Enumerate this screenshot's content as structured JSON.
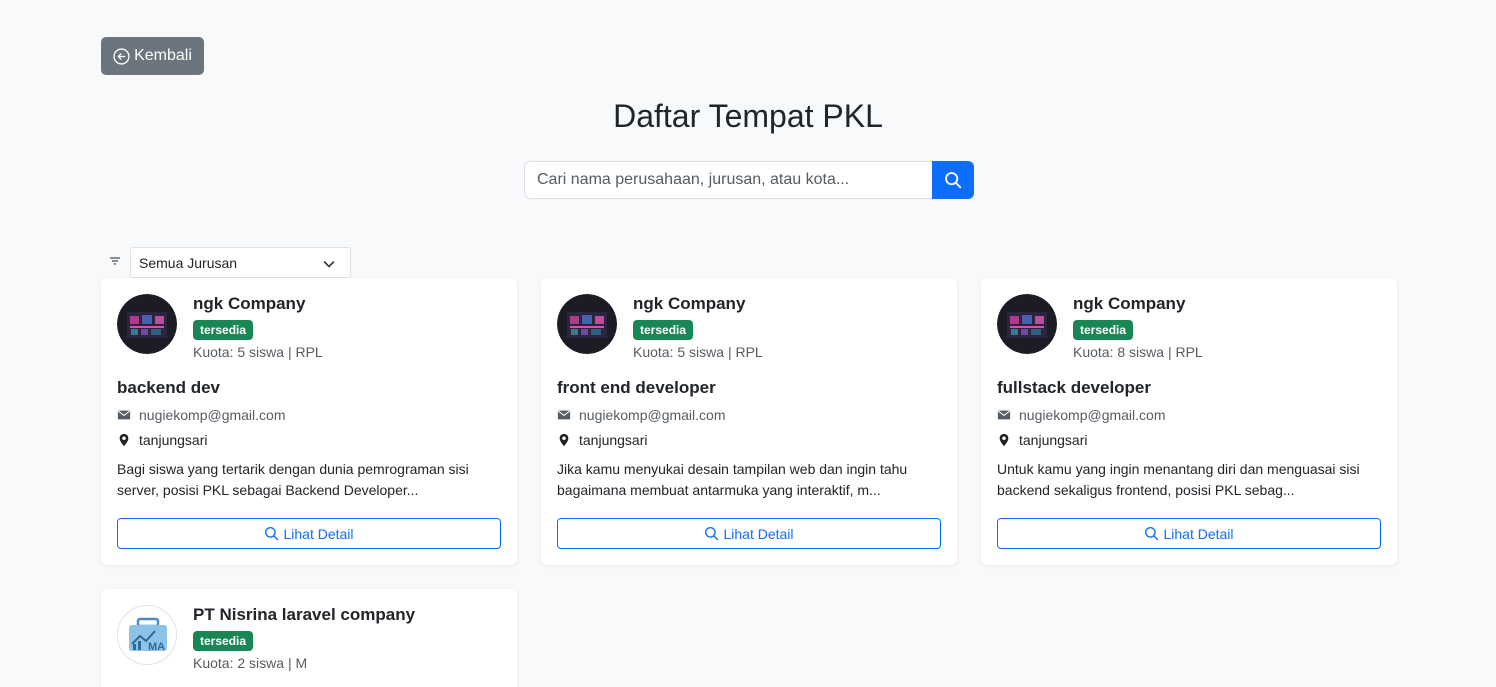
{
  "back_button": {
    "label": "Kembali"
  },
  "page_title": "Daftar Tempat PKL",
  "search": {
    "placeholder": "Cari nama perusahaan, jurusan, atau kota..."
  },
  "filter": {
    "selected": "Semua Jurusan"
  },
  "cards": [
    {
      "company": "ngk Company",
      "status": "tersedia",
      "quota": "Kuota: 5 siswa | RPL",
      "position": "backend dev",
      "email": "nugiekomp@gmail.com",
      "location": "tanjungsari",
      "description": "Bagi siswa yang tertarik dengan dunia pemrograman sisi server, posisi PKL sebagai Backend Developer...",
      "detail_label": "Lihat Detail"
    },
    {
      "company": "ngk Company",
      "status": "tersedia",
      "quota": "Kuota: 5 siswa | RPL",
      "position": "front end developer",
      "email": "nugiekomp@gmail.com",
      "location": "tanjungsari",
      "description": "Jika kamu menyukai desain tampilan web dan ingin tahu bagaimana membuat antarmuka yang interaktif, m...",
      "detail_label": "Lihat Detail"
    },
    {
      "company": "ngk Company",
      "status": "tersedia",
      "quota": "Kuota: 8 siswa | RPL",
      "position": "fullstack developer",
      "email": "nugiekomp@gmail.com",
      "location": "tanjungsari",
      "description": "Untuk kamu yang ingin menantang diri dan menguasai sisi backend sekaligus frontend, posisi PKL sebag...",
      "detail_label": "Lihat Detail"
    },
    {
      "company": "PT Nisrina laravel company",
      "status": "tersedia",
      "quota": "Kuota: 2 siswa | M",
      "logo_text": "MA"
    }
  ],
  "colors": {
    "primary": "#0d6efd",
    "success": "#198754",
    "secondary": "#6c757d",
    "background": "#f8f9fa"
  }
}
